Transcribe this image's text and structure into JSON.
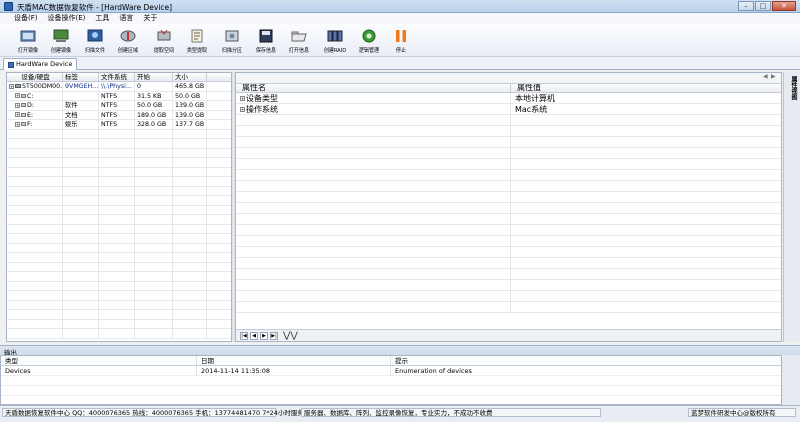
{
  "window": {
    "title": "天盾MAC数据恢复软件 - [HardWare Device]",
    "minimize_glyph": "–",
    "maximize_glyph": "□",
    "close_glyph": "✕"
  },
  "menu": [
    "设备(F)",
    "设备操作(E)",
    "工具",
    "语言",
    "关于"
  ],
  "toolbar": [
    {
      "label": "打开镜像",
      "icon": "open-image-icon"
    },
    {
      "label": "创建镜像",
      "icon": "create-image-icon"
    },
    {
      "label": "扫描文件",
      "icon": "scan-files-icon"
    },
    {
      "label": "创建区域",
      "icon": "create-region-icon"
    },
    {
      "label": "提取空间",
      "icon": "extract-space-icon"
    },
    {
      "label": "类型提取",
      "icon": "type-extract-icon"
    },
    {
      "label": "扫描分区",
      "icon": "scan-partition-icon"
    },
    {
      "label": "保存信息",
      "icon": "save-info-icon"
    },
    {
      "label": "打开信息",
      "icon": "open-info-icon"
    },
    {
      "label": "创建RAID",
      "icon": "create-raid-icon"
    },
    {
      "label": "逻辑管理",
      "icon": "logic-manage-icon"
    },
    {
      "label": "停止",
      "icon": "stop-icon"
    }
  ],
  "tab": {
    "label": "HardWare Device"
  },
  "disk_table": {
    "headers": [
      "设备/硬盘",
      "标签",
      "文件系统",
      "开始",
      "大小"
    ],
    "rows": [
      {
        "device": "ST500DM00...",
        "label": "9VMGEH...",
        "fs": "\\\\.\\Physi...",
        "start": "0",
        "size": "465.8 GB",
        "kind": "disk"
      },
      {
        "device": "C:",
        "label": "",
        "fs": "NTFS",
        "start": "31.5 KB",
        "size": "50.0 GB",
        "kind": "part"
      },
      {
        "device": "D:",
        "label": "软件",
        "fs": "NTFS",
        "start": "50.0 GB",
        "size": "139.0 GB",
        "kind": "part"
      },
      {
        "device": "E:",
        "label": "文档",
        "fs": "NTFS",
        "start": "189.0 GB",
        "size": "139.0 GB",
        "kind": "part"
      },
      {
        "device": "F:",
        "label": "娱乐",
        "fs": "NTFS",
        "start": "328.0 GB",
        "size": "137.7 GB",
        "kind": "part"
      }
    ]
  },
  "prop_table": {
    "headers": [
      "属性名",
      "属性值"
    ],
    "rows": [
      {
        "name": "设备类型",
        "value": "本地计算机"
      },
      {
        "name": "操作系统",
        "value": "Mac系统"
      }
    ]
  },
  "side_panel": {
    "label": "属性视图"
  },
  "output": {
    "title": "输出",
    "headers": [
      "类型",
      "日期",
      "提示"
    ],
    "rows": [
      {
        "type": "Devices",
        "date": "2014-11-14 11:35:08",
        "tip": "Enumeration of devices"
      }
    ]
  },
  "status": {
    "contact": "天盾数据恢复软件中心 QQ：4000076365 热线：4000076365 手机：13774481470  7*24小时服务",
    "services": "服务器、数据库、阵列、监控录像恢复，专业实力，不成功不收费",
    "copyright": "蓝梦软件研发中心@版权所有"
  },
  "colors": {
    "accent": "#2a64b8",
    "link_blue": "#0a2a8c"
  }
}
